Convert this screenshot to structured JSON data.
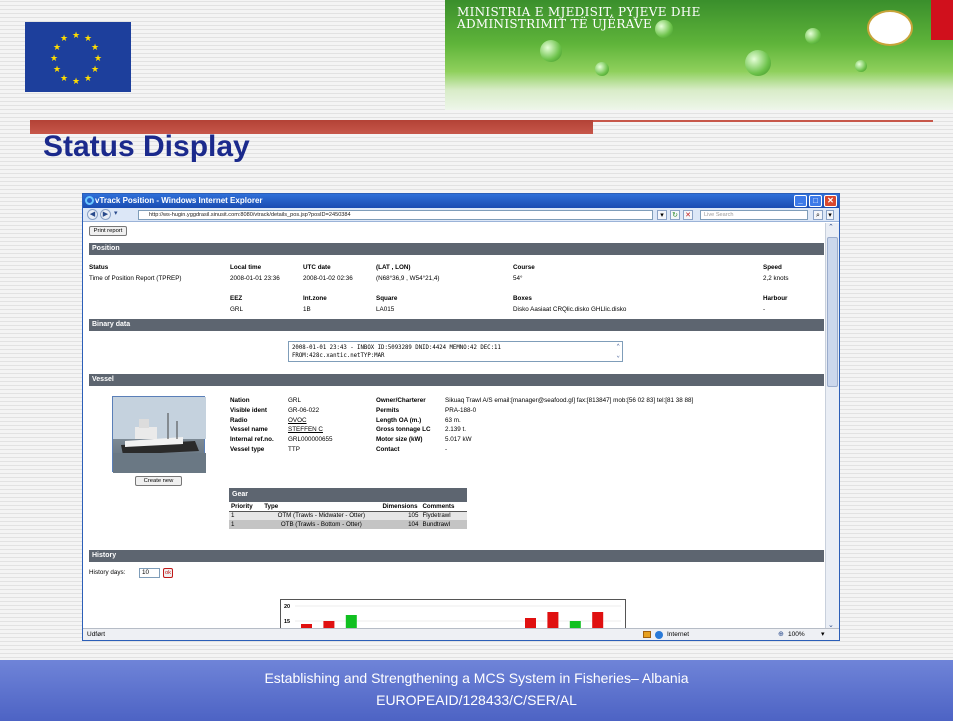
{
  "header": {
    "banner_title_line1": "MINISTRIA E MJEDISIT, PYJEVE DHE",
    "banner_title_line2": "ADMINISTRIMIT TË UJËRAVE"
  },
  "slide_title": "Status Display",
  "browser": {
    "window_title": "vTrack Position - Windows Internet Explorer",
    "url": "http://ws-hugin.yggdrasil.sinusit.com:8080/vtrack/details_pos.jsp?posID=2450384",
    "search_placeholder": "Live Search",
    "status_left": "Udført",
    "status_zone": "Internet",
    "zoom": "100%"
  },
  "page": {
    "print_button": "Print report",
    "position": {
      "heading": "Position",
      "row1_labels": [
        "Status",
        "Local time",
        "UTC date",
        "(LAT , LON)",
        "Course",
        "Speed"
      ],
      "row1_values": [
        "Time of Position Report (TPREP)",
        "2008-01-01 23:36",
        "2008-01-02 02:36",
        "(N68°36,9 , W54°21,4)",
        "54°",
        "2,2 knots"
      ],
      "row2_labels": [
        "EEZ",
        "Int.zone",
        "Square",
        "Boxes",
        "Harbour"
      ],
      "row2_values": [
        "GRL",
        "1B",
        "LA015",
        "Disko Aasiaat CRQlic.disko GHLlic.disko",
        "-"
      ]
    },
    "binary": {
      "heading": "Binary data",
      "line1": "2008-01-01 23:43 - INBOX ID:5093289 DNID:4424 MEMNO:42 DEC:11",
      "line2": "FROM:428c.xantic.netTYP:MAR"
    },
    "vessel": {
      "heading": "Vessel",
      "create_button": "Create new",
      "left_labels": [
        "Nation",
        "Visible ident",
        "Radio",
        "Vessel name",
        "Internal ref.no.",
        "Vessel type"
      ],
      "left_values": [
        "GRL",
        "GR-06-022",
        "OVOC",
        "STEFFEN C",
        "GRL000000655",
        "TTP"
      ],
      "right_labels": [
        "Owner/Charterer",
        "Permits",
        "Length OA (m.)",
        "Gross tonnage LC",
        "Motor size (kW)",
        "Contact"
      ],
      "right_values": [
        "Sikuaq Trawl A/S email:[manager@seafood.gl] fax:[813847] mob:[56 02 83] tel:[81 38 88]",
        "PRA-188-0",
        "63 m.",
        "2.139 t.",
        "5.017 kW",
        "-"
      ]
    },
    "gear": {
      "heading": "Gear",
      "columns": [
        "Priority",
        "Type",
        "Dimensions",
        "Comments"
      ],
      "rows": [
        [
          "1",
          "OTM (Trawls - Midwater - Otter)",
          "105",
          "Flydetrawl"
        ],
        [
          "1",
          "OTB (Trawls - Bottom - Otter)",
          "104",
          "Bundtrawl"
        ]
      ]
    },
    "history": {
      "heading": "History",
      "days_label": "History days:",
      "days_value": "10",
      "ok_button": "ok"
    }
  },
  "chart_data": {
    "type": "bar",
    "y_ticks": [
      "20",
      "15"
    ],
    "series": [
      {
        "color": "#e01010",
        "values": [
          14,
          15,
          null,
          null,
          null,
          null,
          null,
          null,
          null,
          null,
          16,
          18,
          null,
          18
        ]
      },
      {
        "color": "#10c020",
        "values": [
          null,
          null,
          17,
          null,
          null,
          null,
          null,
          null,
          null,
          null,
          null,
          null,
          15,
          null
        ]
      }
    ]
  },
  "footer": {
    "line1": "Establishing and Strengthening a MCS System in Fisheries– Albania",
    "line2": "EUROPEAID/128433/C/SER/AL"
  }
}
